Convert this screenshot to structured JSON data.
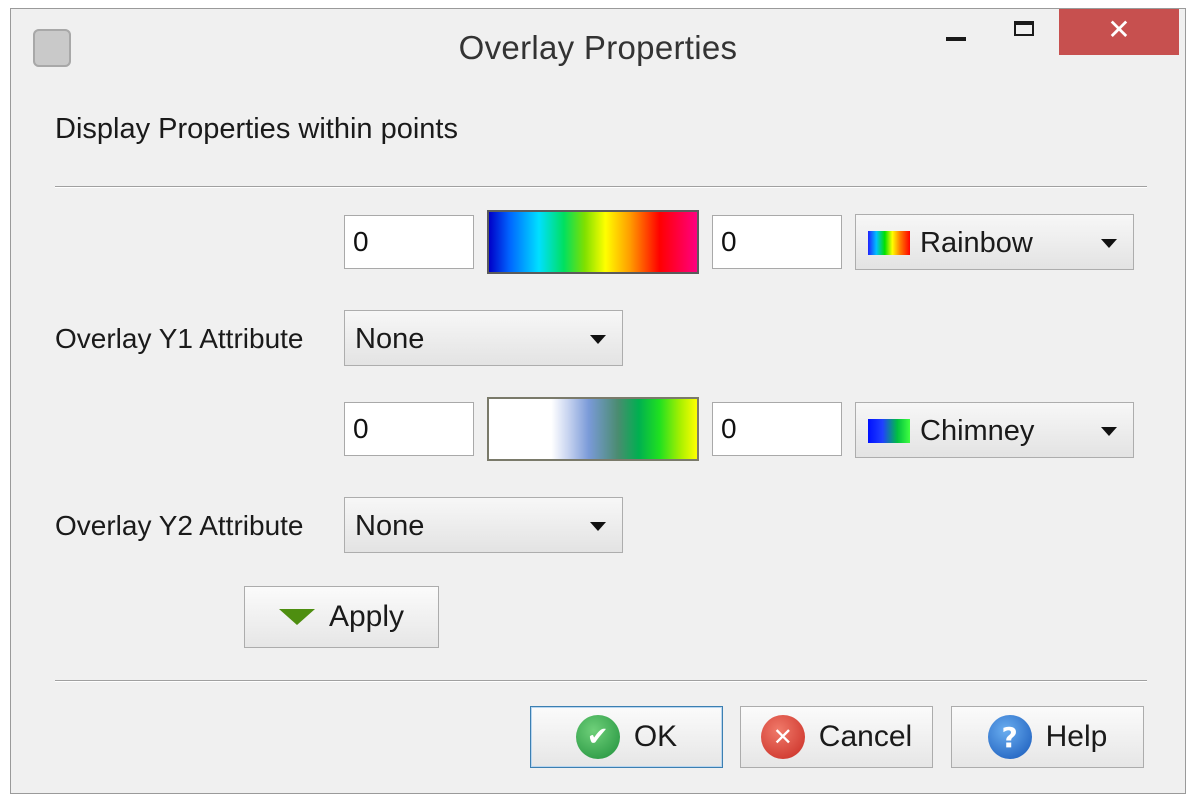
{
  "window": {
    "title": "Overlay Properties",
    "icon": "app-logo-icon",
    "controls": {
      "minimize_icon": "minimize-icon",
      "maximize_icon": "maximize-icon",
      "close_glyph": "✕"
    }
  },
  "heading": "Display Properties within points",
  "y1": {
    "min_value": "0",
    "max_value": "0",
    "colortable": "Rainbow",
    "attribute_label": "Overlay Y1 Attribute",
    "attribute_value": "None"
  },
  "y2": {
    "min_value": "0",
    "max_value": "0",
    "colortable": "Chimney",
    "attribute_label": "Overlay Y2 Attribute",
    "attribute_value": "None"
  },
  "buttons": {
    "apply": "Apply",
    "ok": "OK",
    "cancel": "Cancel",
    "help": "Help"
  },
  "icons": {
    "ok_glyph": "✔",
    "cancel_glyph": "✕",
    "help_glyph": "?"
  },
  "colors": {
    "close_button": "#c7504f",
    "apply_arrow": "#4e8e10",
    "ok_green": "#1e8f3a",
    "cancel_red": "#c82a22",
    "help_blue": "#1556b8"
  }
}
